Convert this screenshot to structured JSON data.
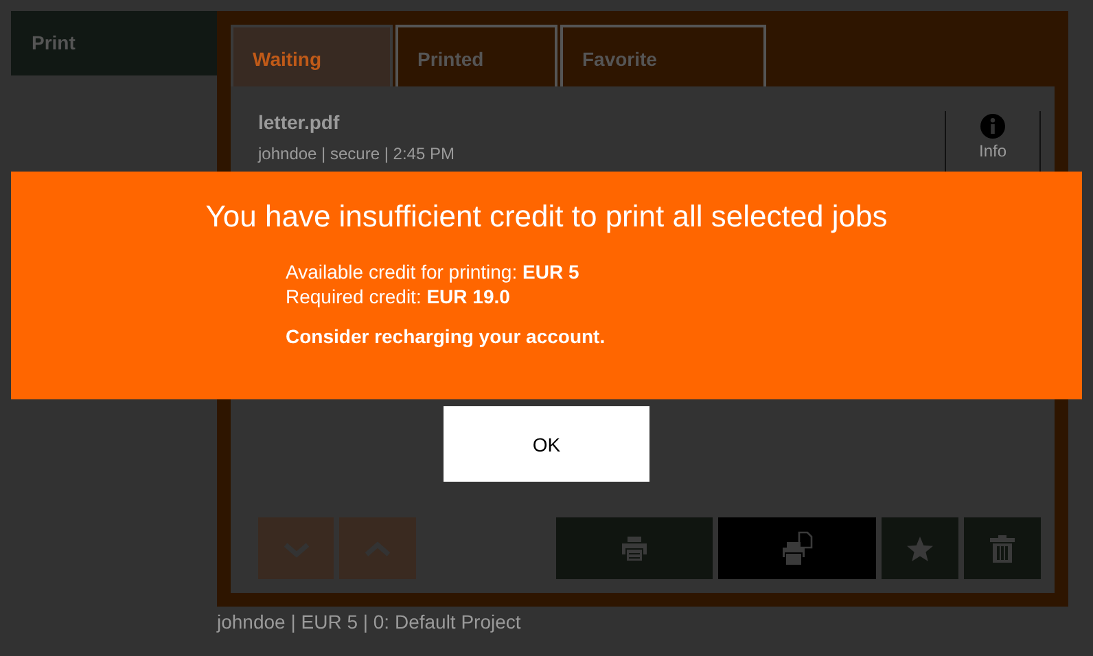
{
  "sidebar": {
    "items": [
      {
        "label": "Print",
        "selected": true
      }
    ]
  },
  "tabs": [
    {
      "label": "Waiting",
      "selected": true
    },
    {
      "label": "Printed",
      "selected": false
    },
    {
      "label": "Favorite",
      "selected": false
    }
  ],
  "jobs": [
    {
      "name": "letter.pdf",
      "meta": "johndoe | secure | 2:45 PM",
      "info_label": "Info"
    }
  ],
  "toolbar": [
    {
      "kind": "down"
    },
    {
      "kind": "up"
    },
    {
      "kind": "print"
    },
    {
      "kind": "print-all"
    },
    {
      "kind": "favorite"
    },
    {
      "kind": "delete"
    }
  ],
  "status_bar": "johndoe | EUR 5 | 0: Default Project",
  "dialog": {
    "title": "You have insufficient credit to print all selected jobs",
    "details": [
      "Available credit for printing: **EUR 5**",
      "Required credit: **EUR 19.0**"
    ],
    "advice": "Consider recharging your account.",
    "ok": "OK"
  }
}
